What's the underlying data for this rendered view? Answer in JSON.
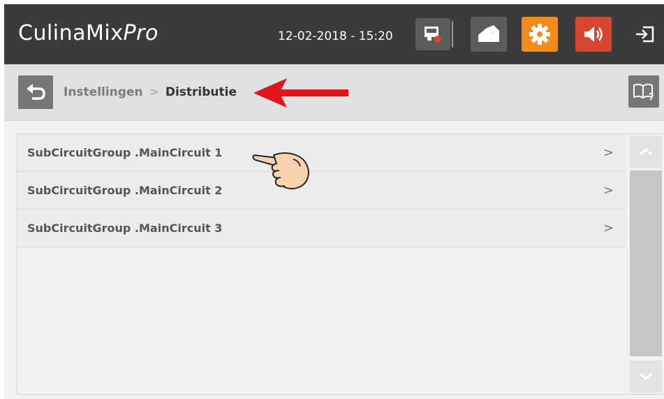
{
  "header": {
    "brand_main": "CulinaMix",
    "brand_suffix": "Pro",
    "datetime": "12-02-2018 - 15:20",
    "buttons": [
      {
        "icon": "screen-record-icon",
        "color": "#5c5c5c"
      },
      {
        "icon": "home-icon",
        "color": "#5c5c5c"
      },
      {
        "icon": "gear-icon",
        "color": "#f28a1c"
      },
      {
        "icon": "speaker-icon",
        "color": "#d7462e"
      },
      {
        "icon": "logout-icon",
        "color": "#5c5c5c"
      }
    ]
  },
  "breadcrumb": {
    "parent": "Instellingen",
    "separator": ">",
    "current": "Distributie"
  },
  "list": {
    "items": [
      {
        "label": "SubCircuitGroup .MainCircuit 1",
        "chevron": ">"
      },
      {
        "label": "SubCircuitGroup .MainCircuit 2",
        "chevron": ">"
      },
      {
        "label": "SubCircuitGroup .MainCircuit 3",
        "chevron": ">"
      }
    ]
  },
  "colors": {
    "header_bg": "#3b3b3b",
    "accent_orange": "#f28a1c",
    "accent_red": "#d7462e",
    "annotation_arrow": "#e0151b"
  }
}
